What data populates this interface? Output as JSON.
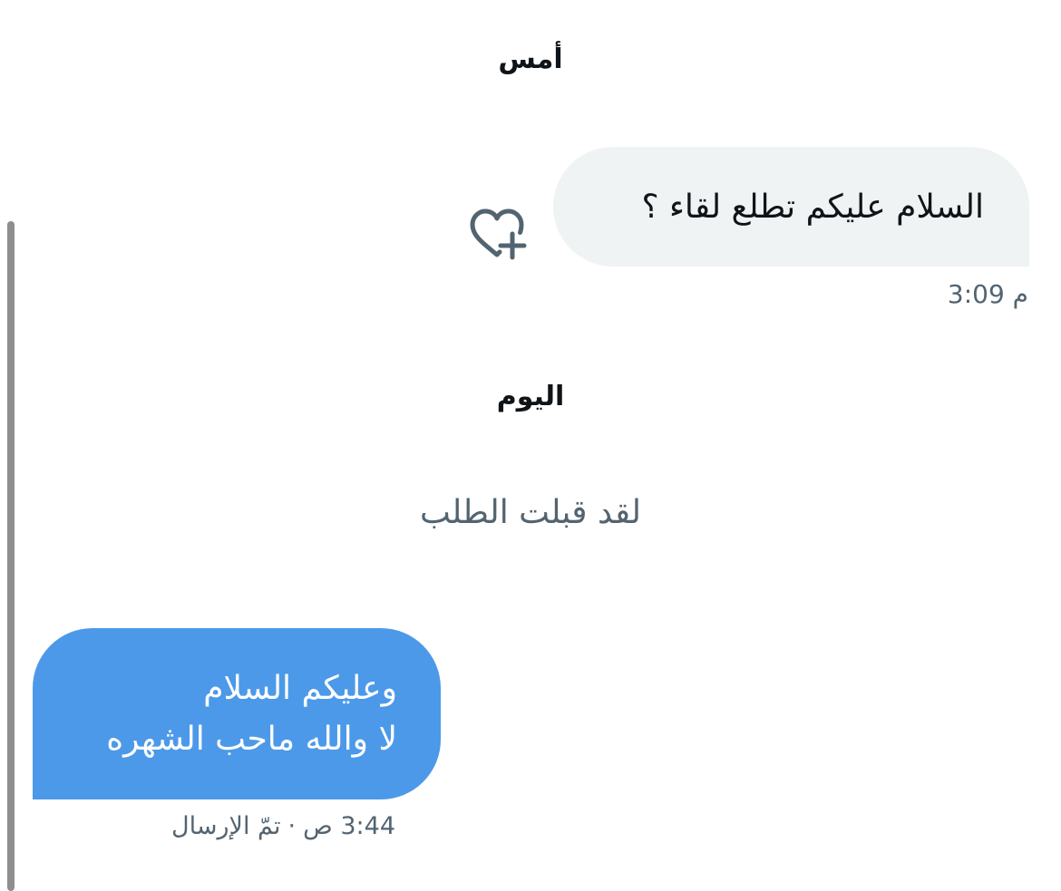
{
  "conversation": {
    "date_yesterday": "أمس",
    "date_today": "اليوم",
    "incoming": {
      "text": "السلام عليكم تطلع لقاء ؟",
      "timestamp": "3:09 م",
      "reaction_icon": "heart-plus-icon"
    },
    "system_message": "لقد قبلت الطلب",
    "outgoing": {
      "lines": [
        "وعليكم السلام",
        "لا والله ماحب الشهره"
      ],
      "time": "3:44 ص",
      "separator": "·",
      "status": "تمّ الإرسال"
    }
  },
  "colors": {
    "incoming_bubble": "#eff3f4",
    "outgoing_bubble": "#4c99e9",
    "secondary_text": "#536471",
    "primary_text": "#0f1419"
  }
}
